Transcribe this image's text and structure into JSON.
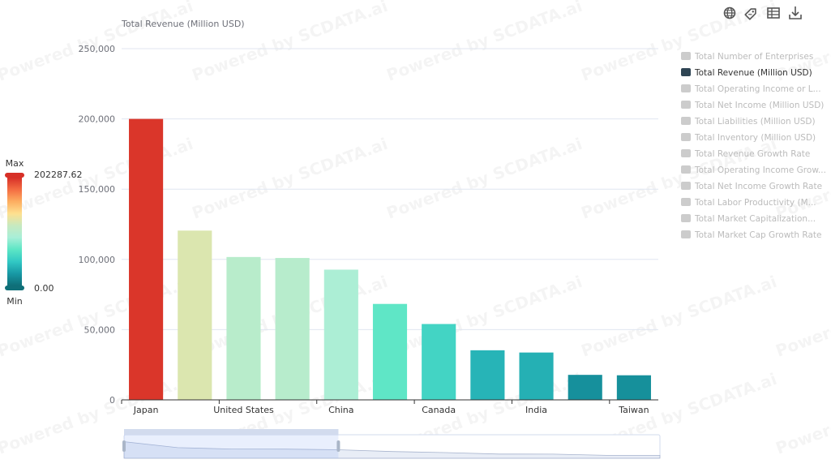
{
  "chart_data": {
    "type": "bar",
    "ylabel": "Total Revenue (Million USD)",
    "ylim": [
      0,
      250000
    ],
    "yticks": [
      0,
      50000,
      100000,
      150000,
      200000,
      250000
    ],
    "ytick_labels": [
      "0",
      "50,000",
      "100,000",
      "150,000",
      "200,000",
      "250,000"
    ],
    "categories": [
      "Japan",
      "",
      "United States",
      "",
      "China",
      "",
      "Canada",
      "",
      "India",
      "",
      "Taiwan"
    ],
    "values": [
      200000,
      120500,
      101700,
      101000,
      92700,
      68300,
      54000,
      35300,
      33700,
      17800,
      17500
    ],
    "grid": true
  },
  "visual_map": {
    "max_label": "Max",
    "min_label": "Min",
    "max_value": "202287.62",
    "min_value": "0.00",
    "colors": [
      "#d73027",
      "#f46d43",
      "#fdae61",
      "#fee090",
      "#c7e9c0",
      "#a8efd8",
      "#5ce6c5",
      "#32c8c4",
      "#1899a5",
      "#0f6f78"
    ]
  },
  "legend": {
    "items": [
      {
        "label": "Total Number of Enterprises",
        "active": false
      },
      {
        "label": "Total Revenue (Million USD)",
        "active": true
      },
      {
        "label": "Total Operating Income or L...",
        "active": false
      },
      {
        "label": "Total Net Income (Million USD)",
        "active": false
      },
      {
        "label": "Total Liabilities (Million USD)",
        "active": false
      },
      {
        "label": "Total Inventory (Million USD)",
        "active": false
      },
      {
        "label": "Total Revenue Growth Rate",
        "active": false
      },
      {
        "label": "Total Operating Income Grow...",
        "active": false
      },
      {
        "label": "Total Net Income Growth Rate",
        "active": false
      },
      {
        "label": "Total Labor Productivity (M...",
        "active": false
      },
      {
        "label": "Total Market Capitalization...",
        "active": false
      },
      {
        "label": "Total Market Cap Growth Rate",
        "active": false
      }
    ],
    "active_color": "#2f4554",
    "inactive_color": "#cccccc"
  },
  "toolbar": {
    "icons": [
      "globe-icon",
      "tag-icon",
      "table-icon",
      "download-icon"
    ]
  },
  "watermark": "Powered by SCDATA.ai",
  "datazoom": {
    "start": 0,
    "end": 0.4
  }
}
